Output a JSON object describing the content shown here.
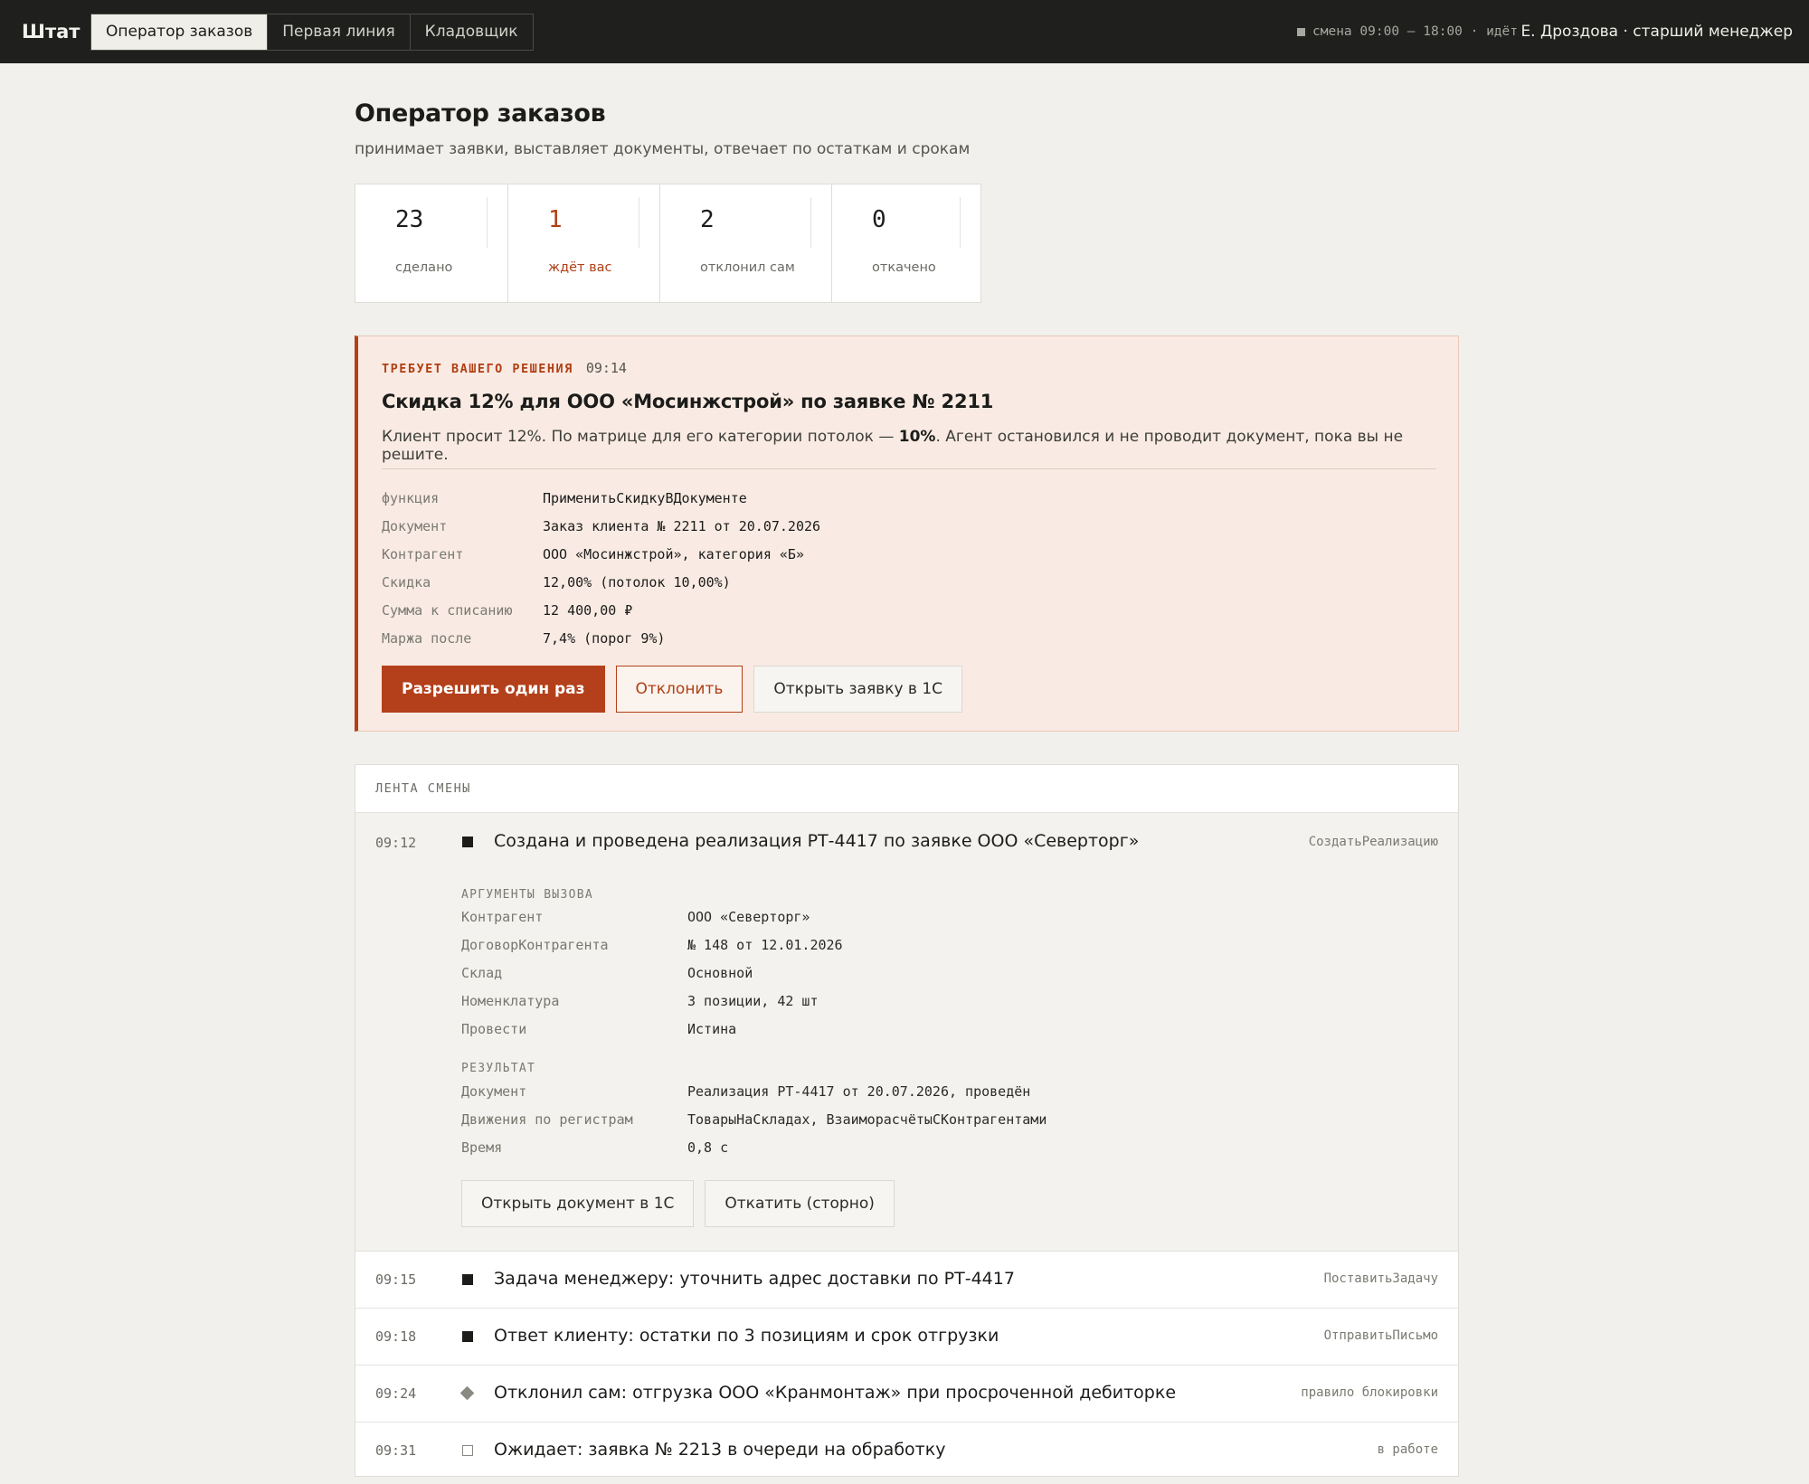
{
  "app": {
    "brand": "Штат",
    "tabs": [
      {
        "label": "Оператор заказов",
        "active": true
      },
      {
        "label": "Первая линия",
        "active": false
      },
      {
        "label": "Кладовщик",
        "active": false
      }
    ],
    "shift_status": "смена 09:00 — 18:00 · идёт",
    "user": "Е. Дроздова · старший менеджер"
  },
  "page": {
    "title": "Оператор заказов",
    "subtitle": "принимает заявки, выставляет документы, отвечает по остаткам и срокам"
  },
  "stats": [
    {
      "value": "23",
      "label": "сделано"
    },
    {
      "value": "1",
      "label": "ждёт вас",
      "accent": "#b03f14"
    },
    {
      "value": "2",
      "label": "отклонил сам"
    },
    {
      "value": "0",
      "label": "откачено"
    }
  ],
  "decision": {
    "kicker": "ТРЕБУЕТ ВАШЕГО РЕШЕНИЯ",
    "time": "09:14",
    "title": "Скидка 12% для ООО «Мосинжстрой» по заявке № 2211",
    "desc_before": "Клиент просит 12%. По матрице для его категории потолок — ",
    "desc_bold": "10%",
    "desc_after": ". Агент остановился и не проводит документ, пока вы не решите.",
    "fields": [
      {
        "k": "функция",
        "v": "ПрименитьСкидкуВДокументе"
      },
      {
        "k": "Документ",
        "v": "Заказ клиента № 2211 от 20.07.2026"
      },
      {
        "k": "Контрагент",
        "v": "ООО «Мосинжстрой», категория «Б»"
      },
      {
        "k": "Скидка",
        "v": "12,00% (потолок 10,00%)"
      },
      {
        "k": "Сумма к списанию",
        "v": "12 400,00 ₽"
      },
      {
        "k": "Маржа после",
        "v": "7,4% (порог 9%)"
      }
    ],
    "actions": {
      "approve": "Разрешить один раз",
      "reject": "Отклонить",
      "open": "Открыть заявку в 1С"
    },
    "accent": "#b3401a",
    "background": "#f9ebe3"
  },
  "feed": {
    "title": "ЛЕНТА СМЕНЫ",
    "expanded": {
      "time": "09:12",
      "status": "done",
      "text": "Создана и проведена реализация РТ-4417 по заявке ООО «Северторг»",
      "fn": "СоздатьРеализацию",
      "args_title": "АРГУМЕНТЫ ВЫЗОВА",
      "args": [
        {
          "k": "Контрагент",
          "v": "ООО «Северторг»"
        },
        {
          "k": "ДоговорКонтрагента",
          "v": "№ 148 от 12.01.2026"
        },
        {
          "k": "Склад",
          "v": "Основной"
        },
        {
          "k": "Номенклатура",
          "v": "3 позиции, 42 шт"
        },
        {
          "k": "Провести",
          "v": "Истина"
        }
      ],
      "result_title": "РЕЗУЛЬТАТ",
      "result": [
        {
          "k": "Документ",
          "v": "Реализация РТ-4417 от 20.07.2026, проведён"
        },
        {
          "k": "Движения по регистрам",
          "v": "ТоварыНаСкладах, ВзаиморасчётыСКонтрагентами"
        },
        {
          "k": "Время",
          "v": "0,8 с"
        }
      ],
      "actions": {
        "open": "Открыть документ в 1С",
        "rollback": "Откатить (сторно)"
      }
    },
    "items": [
      {
        "time": "09:15",
        "status": "done",
        "text": "Задача менеджеру: уточнить адрес доставки по РТ-4417",
        "fn": "ПоставитьЗадачу"
      },
      {
        "time": "09:18",
        "status": "done",
        "text": "Ответ клиенту: остатки по 3 позициям и срок отгрузки",
        "fn": "ОтправитьПисьмо"
      },
      {
        "time": "09:24",
        "status": "rejected",
        "text": "Отклонил сам: отгрузка ООО «Кранмонтаж» при просроченной дебиторке",
        "fn": "правило блокировки"
      },
      {
        "time": "09:31",
        "status": "waiting",
        "text": "Ожидает: заявка № 2213 в очереди на обработку",
        "fn": "в работе"
      }
    ]
  }
}
